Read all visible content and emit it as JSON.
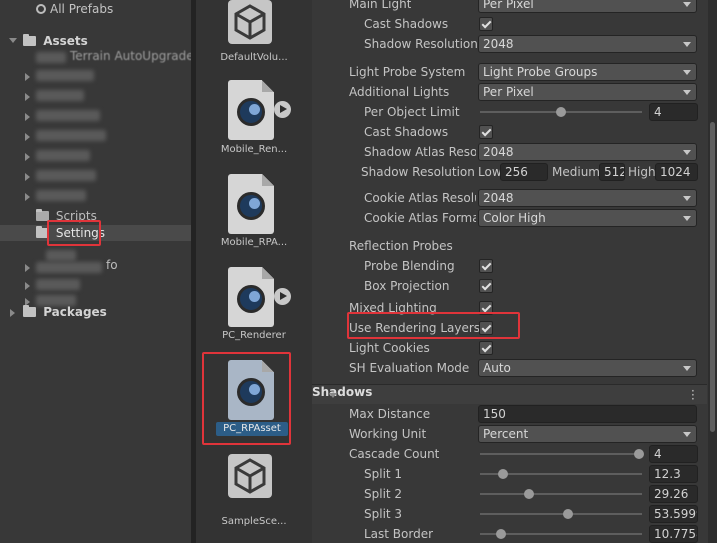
{
  "tree": {
    "all_prefabs": "All Prefabs",
    "assets": "Assets",
    "partial_item": "Terrain AutoUpgrade",
    "scripts": "Scripts",
    "settings": "Settings",
    "partial_fo": "fo",
    "packages": "Packages"
  },
  "assets": [
    {
      "label": "DefaultVolu..."
    },
    {
      "label": "Mobile_Ren..."
    },
    {
      "label": "Mobile_RPA..."
    },
    {
      "label": "PC_Renderer"
    },
    {
      "label": "PC_RPAsset"
    },
    {
      "label": "SampleSce..."
    }
  ],
  "inspector": {
    "main_light": {
      "label": "Main Light",
      "value": "Per Pixel"
    },
    "cast_shadows_1": {
      "label": "Cast Shadows"
    },
    "shadow_resolution": {
      "label": "Shadow Resolution",
      "value": "2048"
    },
    "light_probe_system": {
      "label": "Light Probe System",
      "value": "Light Probe Groups"
    },
    "additional_lights": {
      "label": "Additional Lights",
      "value": "Per Pixel"
    },
    "per_object_limit": {
      "label": "Per Object Limit",
      "value": "4",
      "fraction": 0.5
    },
    "cast_shadows_2": {
      "label": "Cast Shadows"
    },
    "shadow_atlas_res": {
      "label": "Shadow Atlas Resol",
      "value": "2048"
    },
    "shadow_res_tiers": {
      "label": "Shadow Resolution Ti",
      "low_label": "Low",
      "low_value": "256",
      "medium_label": "Medium",
      "medium_value": "512",
      "high_label": "High",
      "high_value": "1024"
    },
    "cookie_atlas_res": {
      "label": "Cookie Atlas Resolu",
      "value": "2048"
    },
    "cookie_atlas_fmt": {
      "label": "Cookie Atlas Format",
      "value": "Color High"
    },
    "reflection_probes": {
      "label": "Reflection Probes"
    },
    "probe_blending": {
      "label": "Probe Blending"
    },
    "box_projection": {
      "label": "Box Projection"
    },
    "mixed_lighting": {
      "label": "Mixed Lighting"
    },
    "use_rendering_layers": {
      "label": "Use Rendering Layers"
    },
    "light_cookies": {
      "label": "Light Cookies"
    },
    "sh_eval_mode": {
      "label": "SH Evaluation Mode",
      "value": "Auto"
    },
    "shadows_header": "Shadows",
    "max_distance": {
      "label": "Max Distance",
      "value": "150"
    },
    "working_unit": {
      "label": "Working Unit",
      "value": "Percent"
    },
    "cascade_count": {
      "label": "Cascade Count",
      "value": "4"
    },
    "split1": {
      "label": "Split 1",
      "value": "12.3"
    },
    "split2": {
      "label": "Split 2",
      "value": "29.26"
    },
    "split3": {
      "label": "Split 3",
      "value": "53.5999"
    },
    "last_border": {
      "label": "Last Border",
      "value": "10.7758"
    }
  },
  "colors": {
    "highlight": "#e0343a",
    "selection": "#2c5d87",
    "panel_bg": "#383838"
  }
}
